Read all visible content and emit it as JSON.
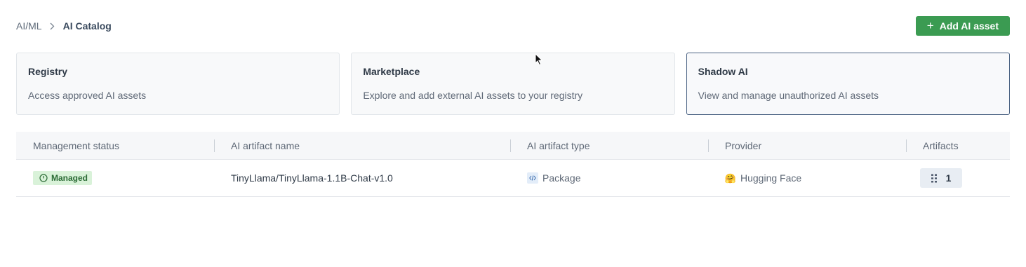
{
  "breadcrumb": {
    "parent": "AI/ML",
    "current": "AI Catalog"
  },
  "actions": {
    "add_asset_label": "Add AI asset"
  },
  "cards": [
    {
      "title": "Registry",
      "description": "Access approved AI assets"
    },
    {
      "title": "Marketplace",
      "description": "Explore and add external AI assets to your registry"
    },
    {
      "title": "Shadow AI",
      "description": "View and manage unauthorized AI assets"
    }
  ],
  "table": {
    "headers": [
      "Management status",
      "AI artifact name",
      "AI artifact type",
      "Provider",
      "Artifacts"
    ],
    "rows": [
      {
        "status": "Managed",
        "name": "TinyLlama/TinyLlama-1.1B-Chat-v1.0",
        "type": "Package",
        "provider": "Hugging Face",
        "artifacts": "1"
      }
    ]
  },
  "colors": {
    "accent": "#3b9b52",
    "selected_border": "#4a6283",
    "badge_bg": "#d9f2d9"
  },
  "icons": {
    "breadcrumb_sep": "chevron-right-icon",
    "add": "plus-icon",
    "status": "clock-icon",
    "type": "code-icon",
    "provider": "hugging-face-icon",
    "artifacts": "list-icon"
  }
}
